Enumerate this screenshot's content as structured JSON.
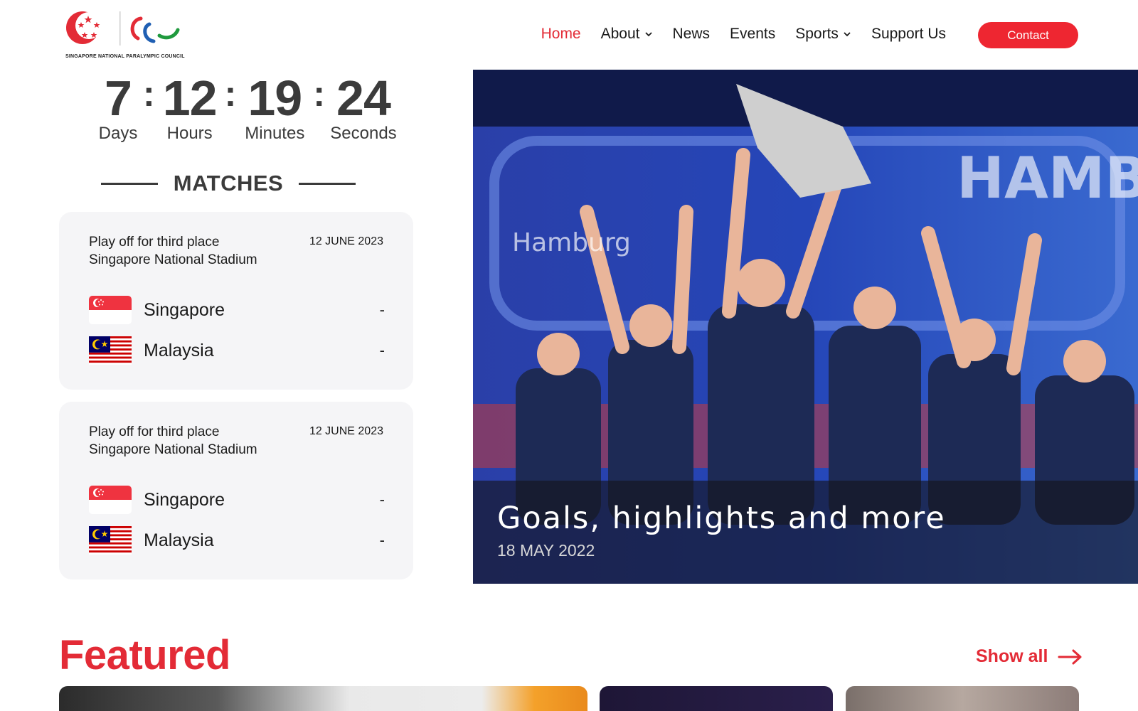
{
  "header": {
    "logo_text": "SINGAPORE NATIONAL PARALYMPIC COUNCIL",
    "nav": [
      {
        "label": "Home",
        "active": true,
        "has_dropdown": false
      },
      {
        "label": "About",
        "active": false,
        "has_dropdown": true
      },
      {
        "label": "News",
        "active": false,
        "has_dropdown": false
      },
      {
        "label": "Events",
        "active": false,
        "has_dropdown": false
      },
      {
        "label": "Sports",
        "active": false,
        "has_dropdown": true
      },
      {
        "label": "Support Us",
        "active": false,
        "has_dropdown": false
      }
    ],
    "contact_label": "Contact"
  },
  "countdown": {
    "days": "7",
    "days_label": "Days",
    "hours": "12",
    "hours_label": "Hours",
    "minutes": "19",
    "minutes_label": "Minutes",
    "seconds": "24",
    "seconds_label": "Seconds",
    "separator": ":"
  },
  "matches": {
    "heading": "MATCHES",
    "cards": [
      {
        "round": "Play off for third place",
        "venue": "Singapore National Stadium",
        "date": "12 JUNE 2023",
        "team_a": {
          "name": "Singapore",
          "score": "-",
          "flag": "singapore-flag-icon"
        },
        "team_b": {
          "name": "Malaysia",
          "score": "-",
          "flag": "malaysia-flag-icon"
        }
      },
      {
        "round": "Play off for third place",
        "venue": "Singapore National Stadium",
        "date": "12 JUNE 2023",
        "team_a": {
          "name": "Singapore",
          "score": "-",
          "flag": "singapore-flag-icon"
        },
        "team_b": {
          "name": "Malaysia",
          "score": "-",
          "flag": "malaysia-flag-icon"
        }
      }
    ]
  },
  "hero": {
    "title": "Goals, highlights and more",
    "date": "18 MAY 2022"
  },
  "featured": {
    "title": "Featured",
    "show_all_label": "Show all"
  },
  "colors": {
    "brand_red": "#e32b36",
    "contact_red": "#ee2631",
    "card_bg": "#f5f5f7",
    "text_dark": "#3b3b3b"
  }
}
